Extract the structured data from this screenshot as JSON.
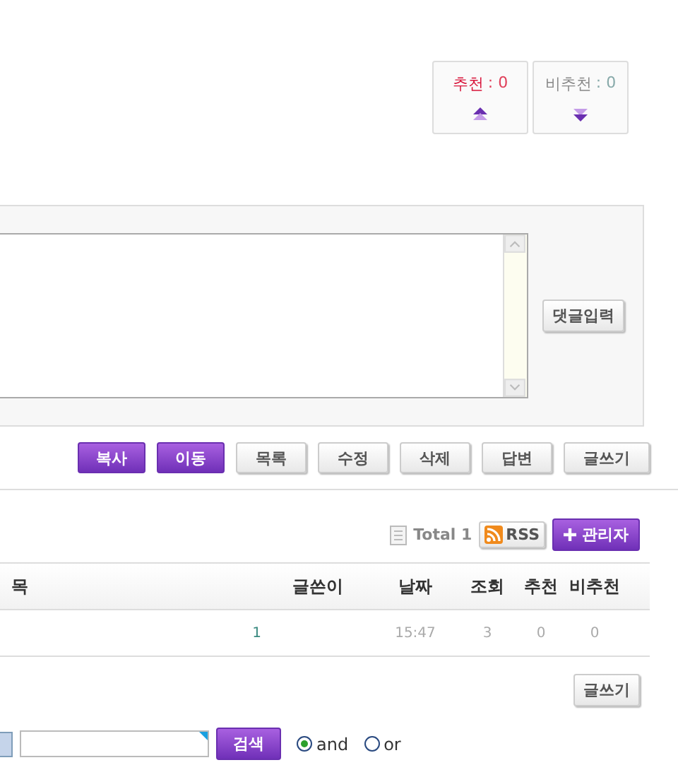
{
  "votes": [
    {
      "kind": "up",
      "label": "추천",
      "separator": ":",
      "count": "0"
    },
    {
      "kind": "down",
      "label": "비추천",
      "separator": ":",
      "count": "0"
    }
  ],
  "comment": {
    "submit": "댓글입력"
  },
  "action_buttons": [
    {
      "label": "복사",
      "kind": "primary"
    },
    {
      "label": "이동",
      "kind": "primary"
    },
    {
      "label": "목록",
      "kind": "default"
    },
    {
      "label": "수정",
      "kind": "default"
    },
    {
      "label": "삭제",
      "kind": "default"
    },
    {
      "label": "답변",
      "kind": "default"
    },
    {
      "label": "글쓰기",
      "kind": "default"
    }
  ],
  "list_bar": {
    "total_label": "Total",
    "total": "1",
    "rss": "RSS",
    "admin": "관리자"
  },
  "table": {
    "columns": [
      "목",
      "글쓴이",
      "날짜",
      "조회",
      "추천",
      "비추천"
    ],
    "rows": [
      {
        "comments": "1",
        "date": "15:47",
        "views": "3",
        "recommend": "0",
        "not_recommend": "0"
      }
    ]
  },
  "write_button": "글쓰기",
  "search": {
    "button": "검색",
    "options": [
      {
        "label": "and",
        "selected": true
      },
      {
        "label": "or",
        "selected": false
      }
    ]
  }
}
